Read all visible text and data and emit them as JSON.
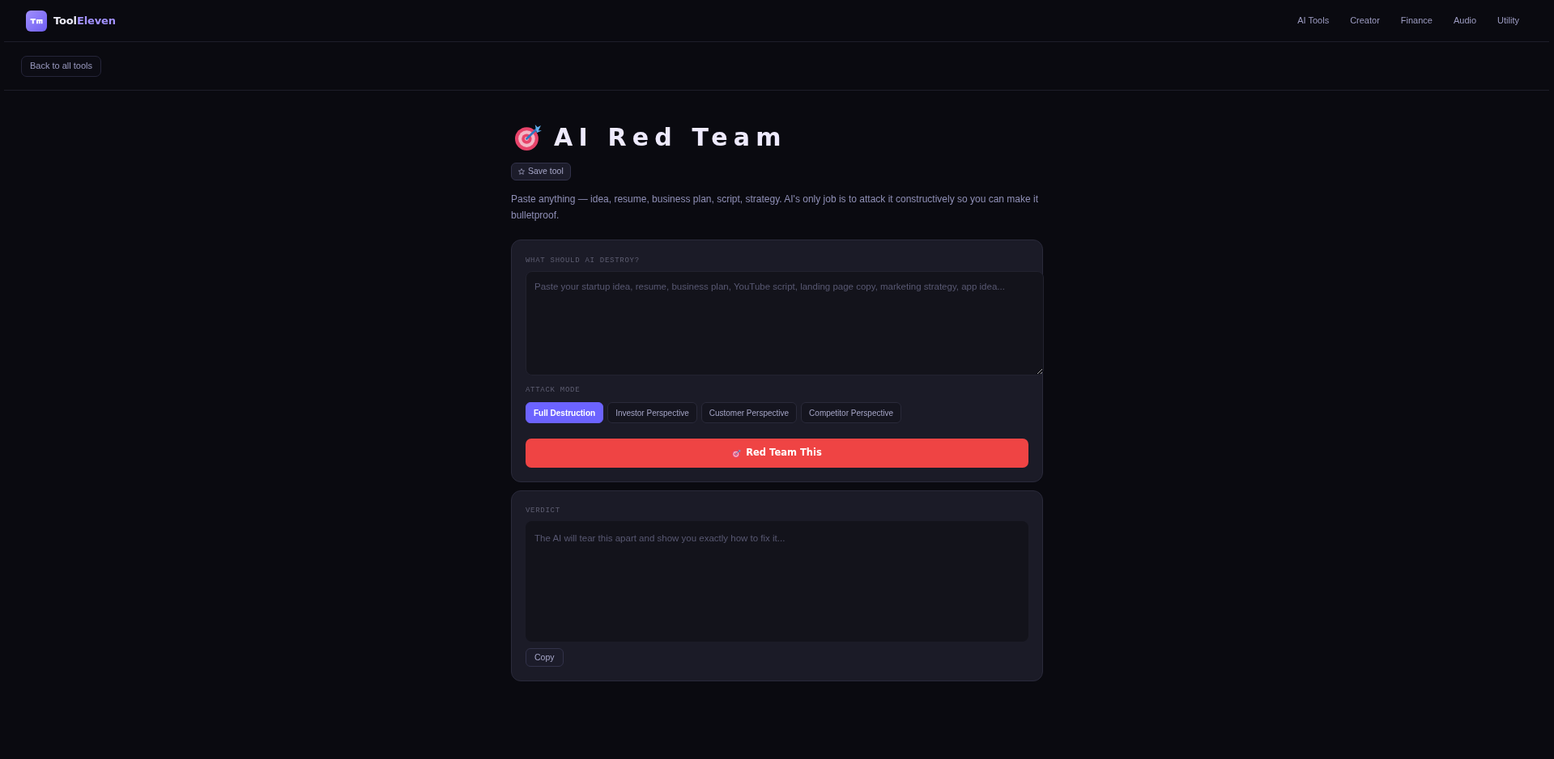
{
  "header": {
    "brand": {
      "parts": [
        {
          "text": "Tool",
          "accent": false
        },
        {
          "text": "Eleven",
          "accent": true
        }
      ]
    },
    "nav": [
      "AI Tools",
      "Creator",
      "Finance",
      "Audio",
      "Utility"
    ]
  },
  "back_button": "Back to all tools",
  "tool": {
    "title": "AI Red Team",
    "save_button": "Save tool",
    "description": "Paste anything — idea, resume, business plan, script, strategy. AI's only job is to attack it constructively so you can make it bulletproof."
  },
  "input_card": {
    "label": "WHAT SHOULD AI DESTROY?",
    "placeholder": "Paste your startup idea, resume, business plan, YouTube script, landing page copy, marketing strategy, app idea...",
    "attack_mode": {
      "label": "ATTACK MODE",
      "options": [
        {
          "label": "Full Destruction",
          "selected": true
        },
        {
          "label": "Investor Perspective",
          "selected": false
        },
        {
          "label": "Customer Perspective",
          "selected": false
        },
        {
          "label": "Competitor Perspective",
          "selected": false
        }
      ]
    },
    "submit_button": "Red Team This"
  },
  "verdict_card": {
    "label": "VERDICT",
    "placeholder": "The AI will tear this apart and show you exactly how to fix it...",
    "copy_button": "Copy"
  }
}
